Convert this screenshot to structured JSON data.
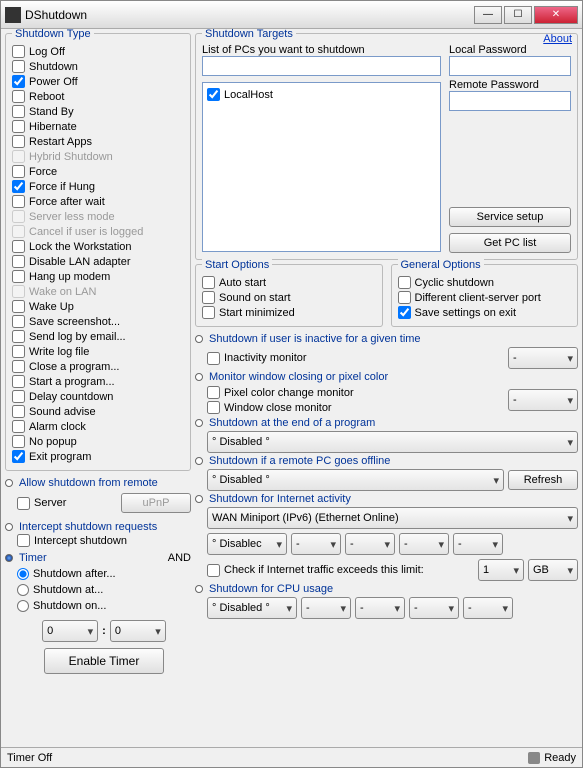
{
  "title": "DShutdown",
  "about": "About",
  "status_left": "Timer Off",
  "status_right": "Ready",
  "shutdown_type": {
    "legend": "Shutdown Type",
    "items": [
      {
        "label": "Log Off",
        "checked": false
      },
      {
        "label": "Shutdown",
        "checked": false
      },
      {
        "label": "Power Off",
        "checked": true
      },
      {
        "label": "Reboot",
        "checked": false
      },
      {
        "label": "Stand By",
        "checked": false
      },
      {
        "label": "Hibernate",
        "checked": false
      },
      {
        "label": "Restart Apps",
        "checked": false
      },
      {
        "label": "Hybrid Shutdown",
        "checked": false,
        "dis": true
      },
      {
        "label": "Force",
        "checked": false
      },
      {
        "label": "Force if Hung",
        "checked": true
      },
      {
        "label": "Force after wait",
        "checked": false
      },
      {
        "label": "Server less mode",
        "checked": false,
        "dis": true
      },
      {
        "label": "Cancel if user is logged",
        "checked": false,
        "dis": true
      },
      {
        "label": "Lock the Workstation",
        "checked": false
      },
      {
        "label": "Disable LAN adapter",
        "checked": false
      },
      {
        "label": "Hang up modem",
        "checked": false
      },
      {
        "label": "Wake on LAN",
        "checked": false,
        "dis": true
      },
      {
        "label": "Wake Up",
        "checked": false
      },
      {
        "label": "Save screenshot...",
        "checked": false
      },
      {
        "label": "Send log by email...",
        "checked": false
      },
      {
        "label": "Write log file",
        "checked": false
      },
      {
        "label": "Close a program...",
        "checked": false
      },
      {
        "label": "Start a program...",
        "checked": false
      },
      {
        "label": "Delay countdown",
        "checked": false
      },
      {
        "label": "Sound advise",
        "checked": false
      },
      {
        "label": "Alarm clock",
        "checked": false
      },
      {
        "label": "No popup",
        "checked": false
      },
      {
        "label": "Exit program",
        "checked": true
      }
    ]
  },
  "allow_remote": {
    "legend": "Allow shutdown from remote",
    "server": "Server",
    "upnp": "uPnP"
  },
  "intercept": {
    "legend": "Intercept shutdown requests",
    "item": "Intercept shutdown"
  },
  "timer": {
    "legend": "Timer",
    "and": "AND",
    "r1": "Shutdown after...",
    "r2": "Shutdown at...",
    "r3": "Shutdown on...",
    "v1": "0",
    "v2": "0",
    "btn": "Enable Timer"
  },
  "targets": {
    "legend": "Shutdown Targets",
    "list_lbl": "List of PCs you want to shutdown",
    "local_lbl": "Local Password",
    "remote_lbl": "Remote Password",
    "localhost": "LocalHost",
    "svc": "Service setup",
    "get": "Get PC list"
  },
  "start_opts": {
    "legend": "Start Options",
    "i1": "Auto start",
    "i2": "Sound on start",
    "i3": "Start minimized"
  },
  "gen_opts": {
    "legend": "General Options",
    "i1": "Cyclic shutdown",
    "i2": "Different client-server port",
    "i3": "Save settings on exit"
  },
  "s_inactive": {
    "lbl": "Shutdown if user is inactive for a given time",
    "c1": "Inactivity monitor",
    "d": "-"
  },
  "s_monitor": {
    "lbl": "Monitor window closing or pixel color",
    "c1": "Pixel color change monitor",
    "c2": "Window close monitor",
    "d": "-"
  },
  "s_endprog": {
    "lbl": "Shutdown at the end of a program",
    "d": "° Disabled °"
  },
  "s_offline": {
    "lbl": "Shutdown if a remote PC goes offline",
    "d": "° Disabled °",
    "r": "Refresh"
  },
  "s_net": {
    "lbl": "Shutdown for Internet activity",
    "adapter": "WAN Miniport (IPv6) (Ethernet Online)",
    "d": "° Disablec",
    "dash": "-",
    "chk": "Check if Internet traffic exceeds this limit:",
    "lim": "1",
    "unit": "GB"
  },
  "s_cpu": {
    "lbl": "Shutdown for CPU usage",
    "d": "° Disabled °",
    "dash": "-"
  }
}
